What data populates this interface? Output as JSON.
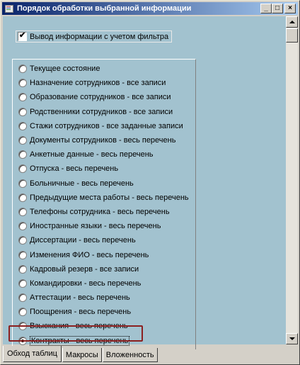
{
  "window": {
    "title": "Порядок обработки выбранной информации",
    "buttons": {
      "minimize": "_",
      "maximize": "□",
      "close": "×"
    }
  },
  "filter": {
    "label": "Вывод информации с учетом фильтра",
    "checked": true
  },
  "options": [
    {
      "label": "Текущее состояние",
      "checked": false
    },
    {
      "label": "Назначение сотрудников   - все записи",
      "checked": false
    },
    {
      "label": "Образование сотрудников  - все записи",
      "checked": false
    },
    {
      "label": "Родственники сотрудников - все записи",
      "checked": false
    },
    {
      "label": "Стажи сотрудников - все заданные записи",
      "checked": false
    },
    {
      "label": "Документы сотрудников - весь перечень",
      "checked": false
    },
    {
      "label": "Анкетные данные - весь перечень",
      "checked": false
    },
    {
      "label": "Отпуска - весь перечень",
      "checked": false
    },
    {
      "label": "Больничные - весь перечень",
      "checked": false
    },
    {
      "label": "Предыдущие места работы - весь перечень",
      "checked": false
    },
    {
      "label": "Телефоны сотрудника - весь перечень",
      "checked": false
    },
    {
      "label": "Иностранные языки - весь перечень",
      "checked": false
    },
    {
      "label": "Диссертации - весь перечень",
      "checked": false
    },
    {
      "label": "Изменения ФИО - весь перечень",
      "checked": false
    },
    {
      "label": "Кадровый резерв - все записи",
      "checked": false
    },
    {
      "label": "Командировки - весь перечень",
      "checked": false
    },
    {
      "label": "Аттестации - весь перечень",
      "checked": false
    },
    {
      "label": "Поощрения  - весь перечень",
      "checked": false
    },
    {
      "label": "Взыскания - весь перечень",
      "checked": false
    },
    {
      "label": "Контракты - весь перечень",
      "checked": true
    }
  ],
  "tabs": [
    {
      "label": "Обход таблиц",
      "active": true
    },
    {
      "label": "Макросы",
      "active": false
    },
    {
      "label": "Вложенность",
      "active": false
    }
  ],
  "colors": {
    "panel_bg": "#a2c2cf",
    "title_start": "#0a246a",
    "title_end": "#a6caf0",
    "highlight_border": "#8b2020"
  },
  "icons": {
    "window": "document-list-icon",
    "checkbox_mark": "checkmark-icon"
  }
}
